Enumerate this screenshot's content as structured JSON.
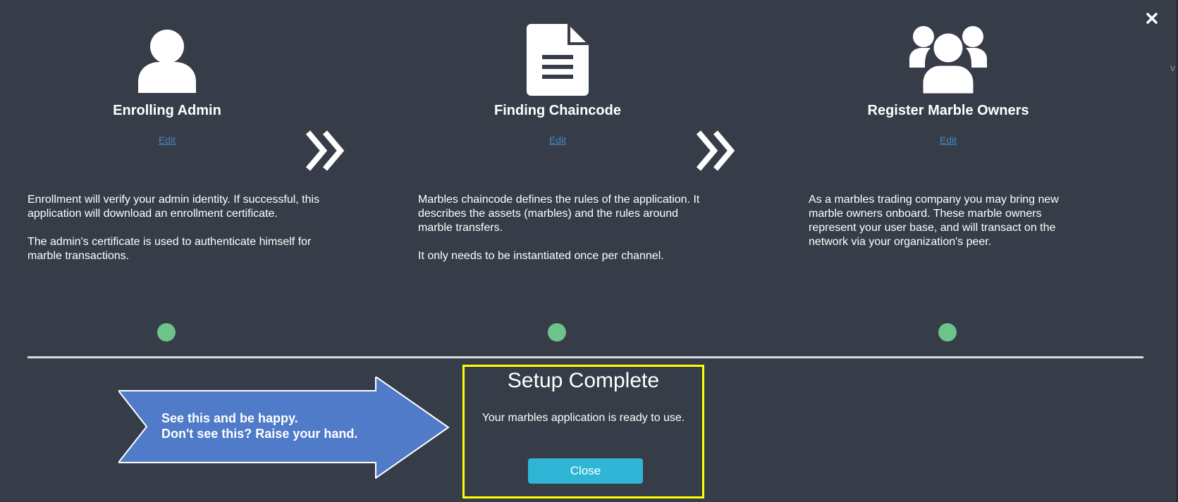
{
  "steps": [
    {
      "icon": "user-icon",
      "title": "Enrolling Admin",
      "edit_label": "Edit",
      "paragraphs": [
        "Enrollment will verify your admin identity. If successful, this application will download an enrollment certificate.",
        "The admin's certificate is used to authenticate himself for marble transactions."
      ],
      "status": "complete"
    },
    {
      "icon": "document-icon",
      "title": "Finding Chaincode",
      "edit_label": "Edit",
      "paragraphs": [
        "Marbles chaincode defines the rules of the application. It describes the assets (marbles) and the rules around marble transfers.",
        "It only needs to be instantiated once per channel."
      ],
      "status": "complete"
    },
    {
      "icon": "users-icon",
      "title": "Register Marble Owners",
      "edit_label": "Edit",
      "paragraphs": [
        "As a marbles trading company you may bring new marble owners onboard. These marble owners represent your user base, and will transact on the network via your organization's peer."
      ],
      "status": "complete"
    }
  ],
  "callout": {
    "line1": "See this and be happy.",
    "line2": "Don't see this?  Raise your hand."
  },
  "completion": {
    "title": "Setup Complete",
    "message": "Your marbles application is ready to use.",
    "close_label": "Close"
  },
  "colors": {
    "background": "#363d48",
    "status_complete": "#6cc48a",
    "highlight_border": "#ffff00",
    "close_button": "#2fb6d6",
    "callout_arrow": "#4f7bc9",
    "link": "#4a86c5"
  }
}
